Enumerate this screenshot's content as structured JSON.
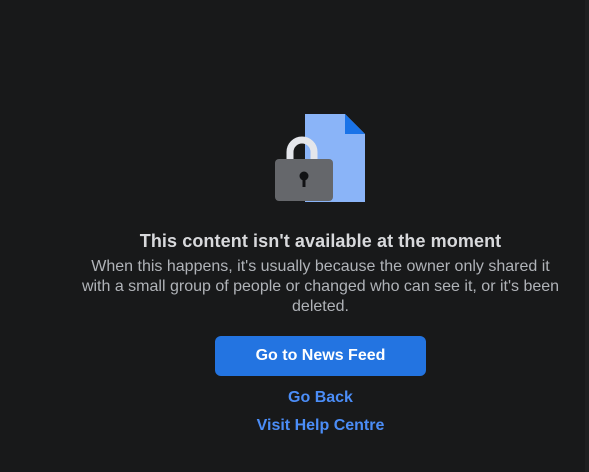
{
  "message": {
    "title": "This content isn't available at the moment",
    "body": "When this happens, it's usually because the owner only shared it with a small group of people or changed who can see it, or it's been deleted."
  },
  "actions": {
    "primary_label": "Go to News Feed",
    "go_back_label": "Go Back",
    "help_label": "Visit Help Centre"
  },
  "icons": {
    "illustration": "lock-document-icon"
  },
  "colors": {
    "background": "#18191a",
    "title_text": "#d8d9dc",
    "body_text": "#b0b3b8",
    "primary_button": "#2374e1",
    "link_text": "#4b8df7",
    "document_fill": "#8ab4f8",
    "document_fold": "#1a73e8",
    "lock_body": "#65676b",
    "lock_shackle": "#e4e6eb"
  }
}
